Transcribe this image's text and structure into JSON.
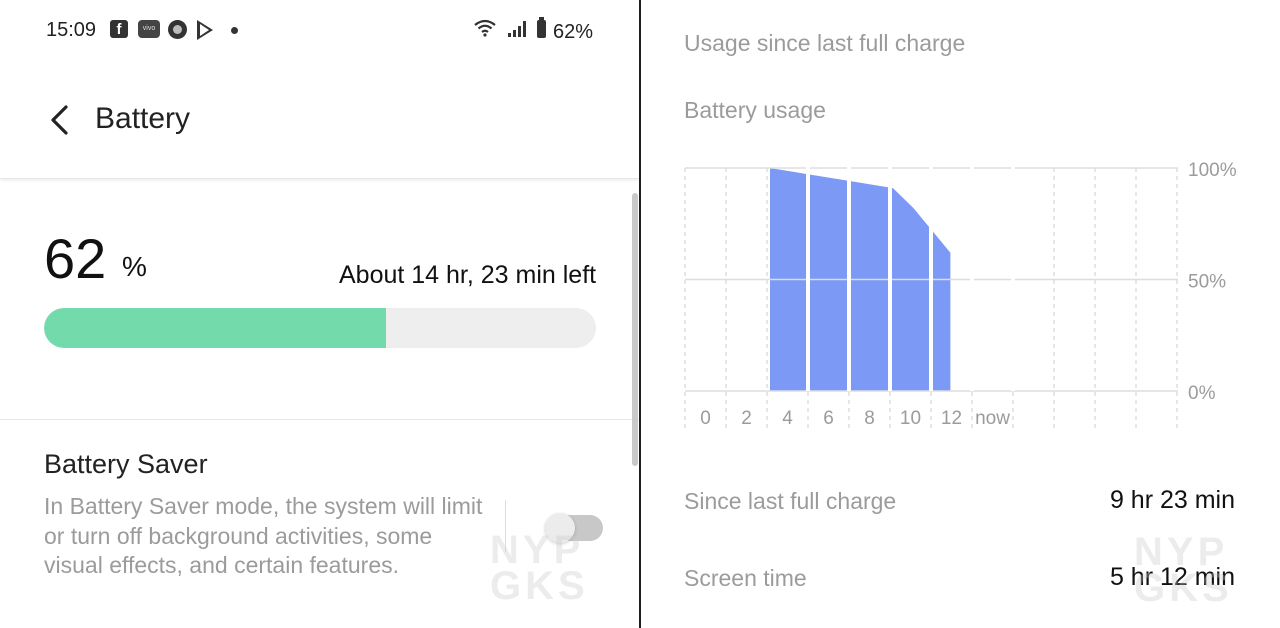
{
  "status_bar": {
    "time": "15:09",
    "battery_percent": "62%"
  },
  "header": {
    "title": "Battery"
  },
  "battery": {
    "level": "62",
    "unit": "%",
    "time_left": "About 14 hr, 23 min left",
    "level_fraction": 0.62,
    "fill_color": "#73dbab"
  },
  "battery_saver": {
    "title": "Battery Saver",
    "description": "In Battery Saver mode, the system will limit or turn off background activities, some visual effects, and certain features.",
    "enabled": false
  },
  "usage": {
    "section_title": "Usage since last full charge",
    "chart_title": "Battery usage",
    "stats": [
      {
        "label": "Since last full charge",
        "value": "9 hr 23 min"
      },
      {
        "label": "Screen time",
        "value": "5 hr 12 min"
      }
    ]
  },
  "watermark": {
    "line1": "NYP",
    "line2": "GKS"
  },
  "chart_data": {
    "type": "bar",
    "categories": [
      "0",
      "2",
      "4",
      "6",
      "8",
      "10",
      "12",
      "now"
    ],
    "values": [
      null,
      null,
      100,
      97,
      94,
      91,
      82,
      62
    ],
    "area_points": [
      [
        4,
        100
      ],
      [
        6,
        97
      ],
      [
        8,
        94
      ],
      [
        10,
        91
      ],
      [
        11,
        82
      ],
      [
        12.8,
        62
      ]
    ],
    "ylim": [
      0,
      100
    ],
    "yticks": [
      "100%",
      "50%",
      "0%"
    ],
    "grid": true,
    "color": "#7b99f5"
  }
}
